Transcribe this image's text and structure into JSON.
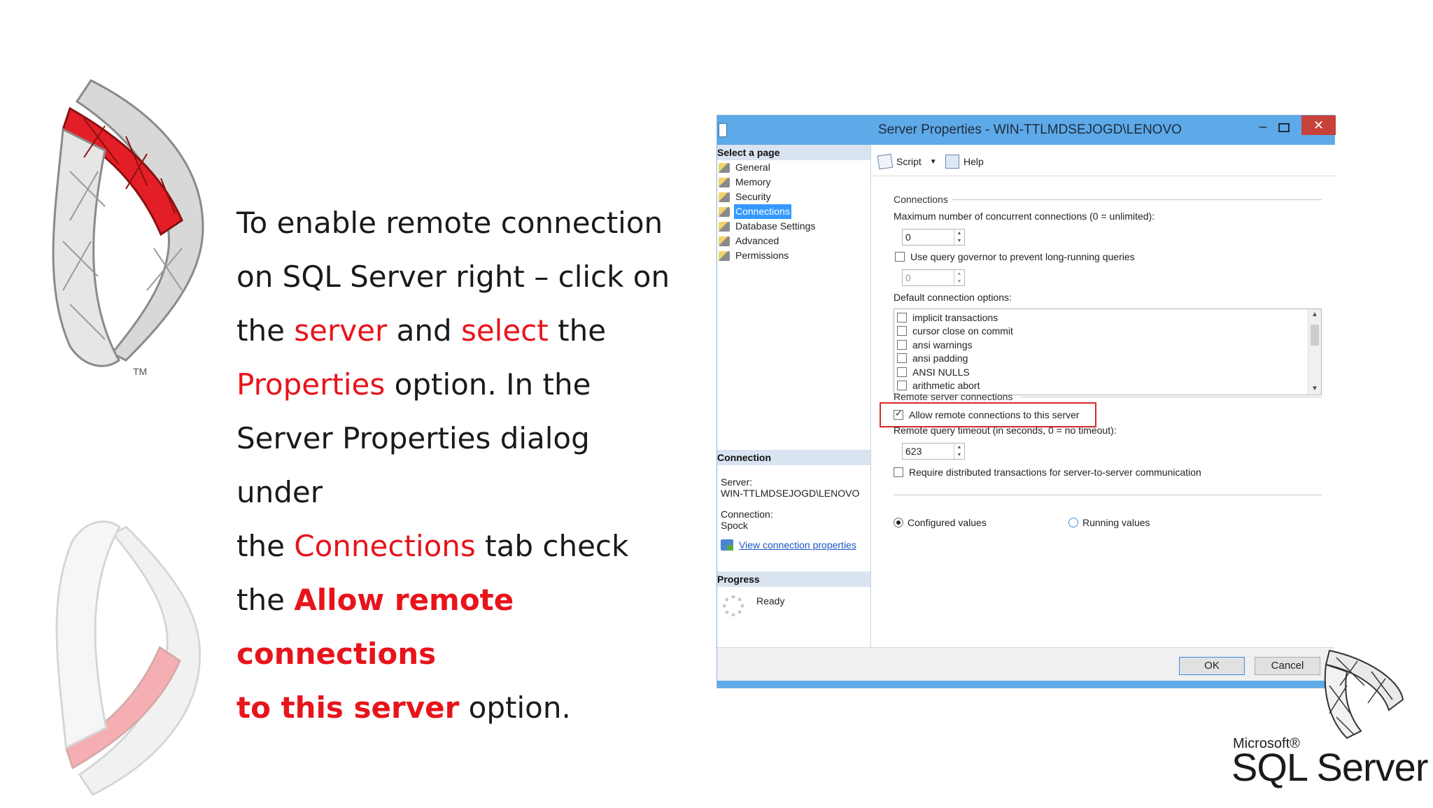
{
  "instructions": {
    "line1": "To enable remote connection",
    "line2": "on SQL Server right – click on",
    "line3_a": "the ",
    "line3_b": "server",
    "line3_c": " and ",
    "line3_d": "select",
    "line3_e": " the",
    "line4_a": "Properties",
    "line4_b": " option. In the",
    "line5": "Server Properties dialog under",
    "line6_a": "the ",
    "line6_b": "Connections",
    "line6_c": " tab check",
    "line7_a": "the ",
    "line7_b": "Allow remote connections",
    "line8_a": "to this server",
    "line8_b": " option."
  },
  "logo": {
    "tm": "TM"
  },
  "dialog": {
    "title": "Server Properties - WIN-TTLMDSEJOGD\\LENOVO",
    "close": "✕",
    "select_page_header": "Select a page",
    "pages": [
      "General",
      "Memory",
      "Security",
      "Connections",
      "Database Settings",
      "Advanced",
      "Permissions"
    ],
    "connection_header": "Connection",
    "server_label": "Server:",
    "server_value": "WIN-TTLMDSEJOGD\\LENOVO",
    "connection_label": "Connection:",
    "connection_value": "Spock",
    "view_link": "View connection properties",
    "progress_header": "Progress",
    "progress_status": "Ready",
    "toolbar": {
      "script": "Script",
      "help": "Help"
    },
    "connections_group": "Connections",
    "max_conn_label": "Maximum number of concurrent connections (0 = unlimited):",
    "max_conn_value": "0",
    "governor_label": "Use query governor to prevent long-running queries",
    "governor_value": "0",
    "default_opts_label": "Default connection options:",
    "default_opts": [
      "implicit transactions",
      "cursor close on commit",
      "ansi warnings",
      "ansi padding",
      "ANSI NULLS",
      "arithmetic abort"
    ],
    "remote_group": "Remote server connections",
    "allow_remote_label": "Allow remote connections to this server",
    "timeout_label": "Remote query timeout (in seconds, 0 = no timeout):",
    "timeout_value": "623",
    "distributed_label": "Require distributed transactions for server-to-server communication",
    "configured_values": "Configured values",
    "running_values": "Running values",
    "ok": "OK",
    "cancel": "Cancel"
  },
  "brand": {
    "microsoft": "Microsoft®",
    "sql_server": "SQL Server"
  },
  "colors": {
    "accent_red": "#e8141b",
    "title_blue": "#5ea9e8",
    "highlight_red": "#d62a2a"
  }
}
